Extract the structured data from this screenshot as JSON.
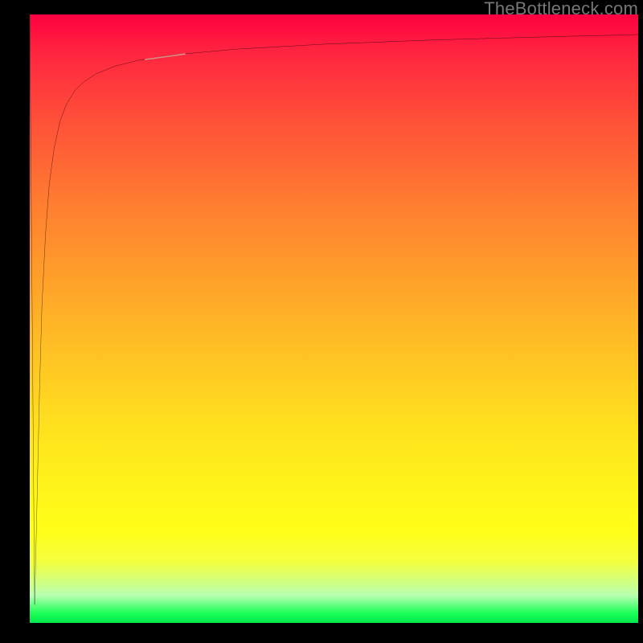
{
  "watermark": "TheBottleneck.com",
  "chart_data": {
    "type": "line",
    "title": "",
    "xlabel": "",
    "ylabel": "",
    "xlim": [
      0,
      100
    ],
    "ylim": [
      0,
      100
    ],
    "legend": false,
    "grid": false,
    "series": [
      {
        "name": "bottleneck-curve",
        "color": "#000000",
        "x": [
          0.0,
          0.8,
          1.2,
          1.6,
          2.0,
          2.6,
          3.2,
          4.0,
          5.0,
          6.0,
          7.5,
          9.0,
          11.0,
          14.0,
          18.0,
          24.0,
          34.0,
          48.0,
          66.0,
          84.0,
          100.0
        ],
        "y": [
          100.0,
          3.0,
          20.0,
          38.0,
          52.0,
          64.0,
          72.0,
          78.0,
          82.5,
          85.2,
          87.6,
          89.0,
          90.3,
          91.5,
          92.5,
          93.4,
          94.3,
          95.1,
          95.8,
          96.3,
          96.7
        ]
      }
    ],
    "highlight": {
      "name": "highlight-segment",
      "color": "#d98f88",
      "x_range": [
        19.0,
        25.5
      ],
      "y_range": [
        92.6,
        93.5
      ]
    },
    "background_gradient": {
      "direction": "vertical",
      "stops": [
        {
          "pos": 0.0,
          "color": "#ff0040"
        },
        {
          "pos": 0.5,
          "color": "#ffb225"
        },
        {
          "pos": 0.86,
          "color": "#fffe18"
        },
        {
          "pos": 0.985,
          "color": "#1bff58"
        },
        {
          "pos": 1.0,
          "color": "#00e84a"
        }
      ]
    }
  }
}
